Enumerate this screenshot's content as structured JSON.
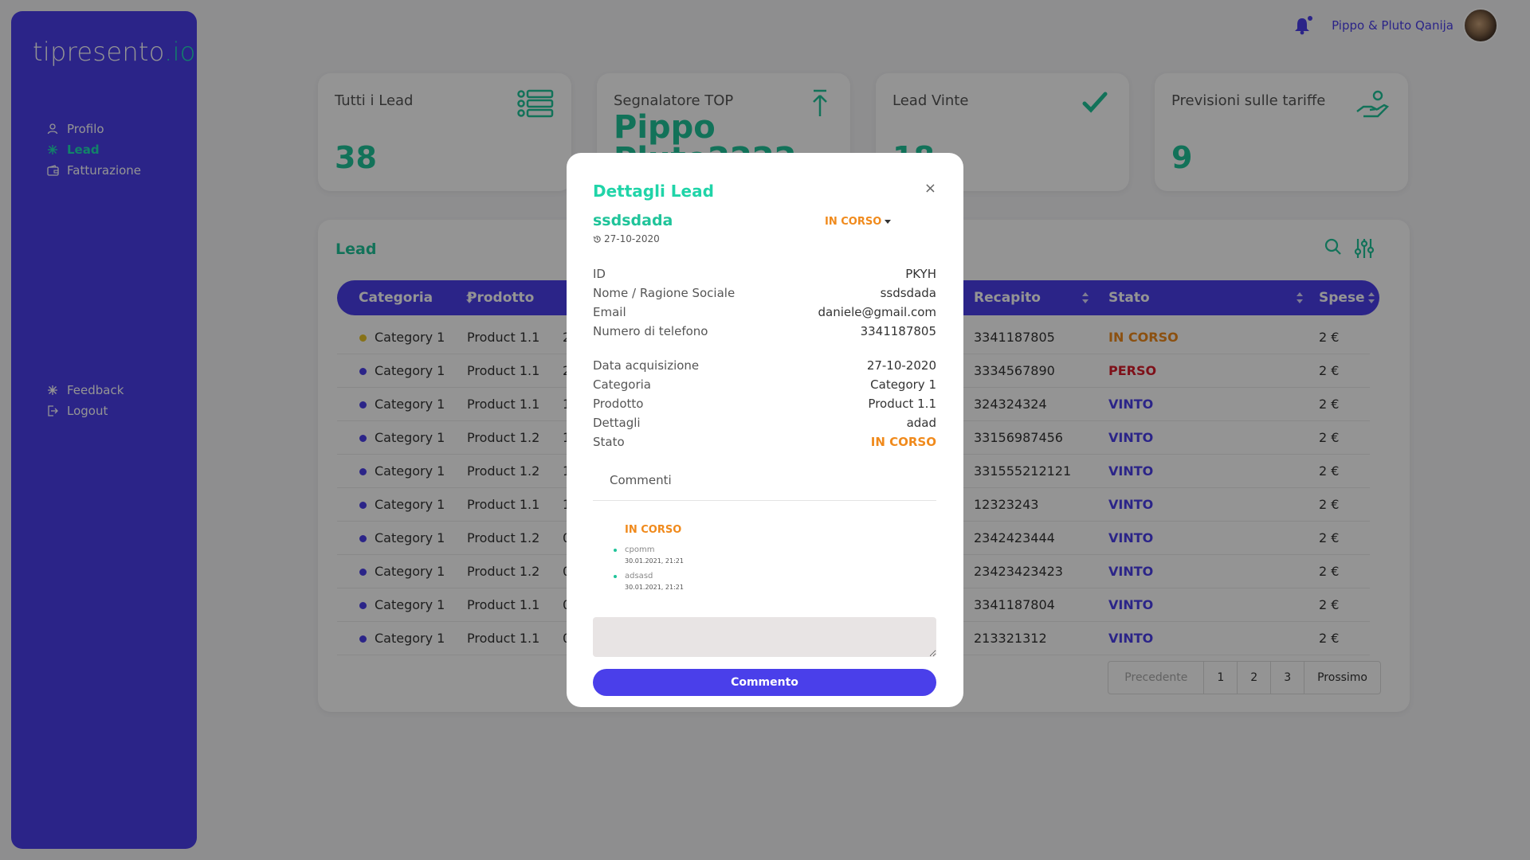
{
  "app": {
    "logo_main": "tipresento",
    "logo_suffix": ".io"
  },
  "sidebar": {
    "top_items": [
      {
        "label": "Profilo",
        "icon": "user-icon",
        "active": false
      },
      {
        "label": "Lead",
        "icon": "asterisk-icon",
        "active": true
      },
      {
        "label": "Fatturazione",
        "icon": "wallet-icon",
        "active": false
      }
    ],
    "bottom_items": [
      {
        "label": "Feedback",
        "icon": "asterisk-icon"
      },
      {
        "label": "Logout",
        "icon": "logout-icon"
      }
    ]
  },
  "header": {
    "username": "Pippo & Pluto Qanija"
  },
  "stats": [
    {
      "title": "Tutti i Lead",
      "value": "38",
      "icon": "list-icon"
    },
    {
      "title": "Segnalatore TOP",
      "value": "Pippo Pluto2222",
      "icon": "upload-arrow-icon"
    },
    {
      "title": "Lead Vinte",
      "value": "18",
      "icon": "check-icon"
    },
    {
      "title": "Previsioni sulle tariffe",
      "value": "9",
      "icon": "hand-money-icon"
    }
  ],
  "panel": {
    "title": "Lead",
    "columns": [
      "Categoria",
      "Prodotto",
      "Recapito",
      "Stato",
      "Spese"
    ],
    "rows": [
      {
        "categoria": "Category 1",
        "prodotto": "Product 1.1",
        "extra": "2",
        "recapito": "3341187805",
        "stato": "IN CORSO",
        "spese": "2 €",
        "bullet": "#e8c52a"
      },
      {
        "categoria": "Category 1",
        "prodotto": "Product 1.1",
        "extra": "2",
        "recapito": "3334567890",
        "stato": "PERSO",
        "spese": "2 €",
        "bullet": "#4a3fea"
      },
      {
        "categoria": "Category 1",
        "prodotto": "Product 1.1",
        "extra": "1",
        "recapito": "324324324",
        "stato": "VINTO",
        "spese": "2 €",
        "bullet": "#4a3fea"
      },
      {
        "categoria": "Category 1",
        "prodotto": "Product 1.2",
        "extra": "1",
        "recapito": "33156987456",
        "stato": "VINTO",
        "spese": "2 €",
        "bullet": "#4a3fea"
      },
      {
        "categoria": "Category 1",
        "prodotto": "Product 1.2",
        "extra": "1",
        "recapito": "331555212121",
        "stato": "VINTO",
        "spese": "2 €",
        "bullet": "#4a3fea"
      },
      {
        "categoria": "Category 1",
        "prodotto": "Product 1.1",
        "extra": "1",
        "recapito": "12323243",
        "stato": "VINTO",
        "spese": "2 €",
        "bullet": "#4a3fea"
      },
      {
        "categoria": "Category 1",
        "prodotto": "Product 1.2",
        "extra": "0",
        "recapito": "2342423444",
        "stato": "VINTO",
        "spese": "2 €",
        "bullet": "#4a3fea"
      },
      {
        "categoria": "Category 1",
        "prodotto": "Product 1.2",
        "extra": "0",
        "recapito": "23423423423",
        "stato": "VINTO",
        "spese": "2 €",
        "bullet": "#4a3fea"
      },
      {
        "categoria": "Category 1",
        "prodotto": "Product 1.1",
        "extra": "0",
        "recapito": "3341187804",
        "stato": "VINTO",
        "spese": "2 €",
        "bullet": "#4a3fea"
      },
      {
        "categoria": "Category 1",
        "prodotto": "Product 1.1",
        "extra": "0",
        "recapito": "213321312",
        "stato": "VINTO",
        "spese": "2 €",
        "bullet": "#4a3fea"
      }
    ],
    "pagination": {
      "prev": "Precedente",
      "pages": [
        "1",
        "2",
        "3"
      ],
      "next": "Prossimo"
    }
  },
  "modal": {
    "title": "Dettagli Lead",
    "close": "×",
    "lead_name": "ssdsdada",
    "lead_date": "27-10-2020",
    "status": "IN CORSO",
    "details_a": [
      {
        "key": "ID",
        "value": "PKYH"
      },
      {
        "key": "Nome / Ragione Sociale",
        "value": "ssdsdada"
      },
      {
        "key": "Email",
        "value": "daniele@gmail.com"
      },
      {
        "key": "Numero di telefono",
        "value": "3341187805"
      }
    ],
    "details_b": [
      {
        "key": "Data acquisizione",
        "value": "27-10-2020"
      },
      {
        "key": "Categoria",
        "value": "Category 1"
      },
      {
        "key": "Prodotto",
        "value": "Product 1.1"
      },
      {
        "key": "Dettagli",
        "value": "adad"
      },
      {
        "key": "Stato",
        "value": "IN CORSO"
      }
    ],
    "comments_label": "Commenti",
    "comments_status": "IN CORSO",
    "comments": [
      {
        "text": "cpomm",
        "date": "30.01.2021, 21:21"
      },
      {
        "text": "adsasd",
        "date": "30.01.2021, 21:21"
      }
    ],
    "button": "Commento"
  },
  "colors": {
    "brand": "#4a3fea",
    "accent": "#20c49a",
    "in_corso": "#f08a1c",
    "perso": "#d91c2b"
  }
}
